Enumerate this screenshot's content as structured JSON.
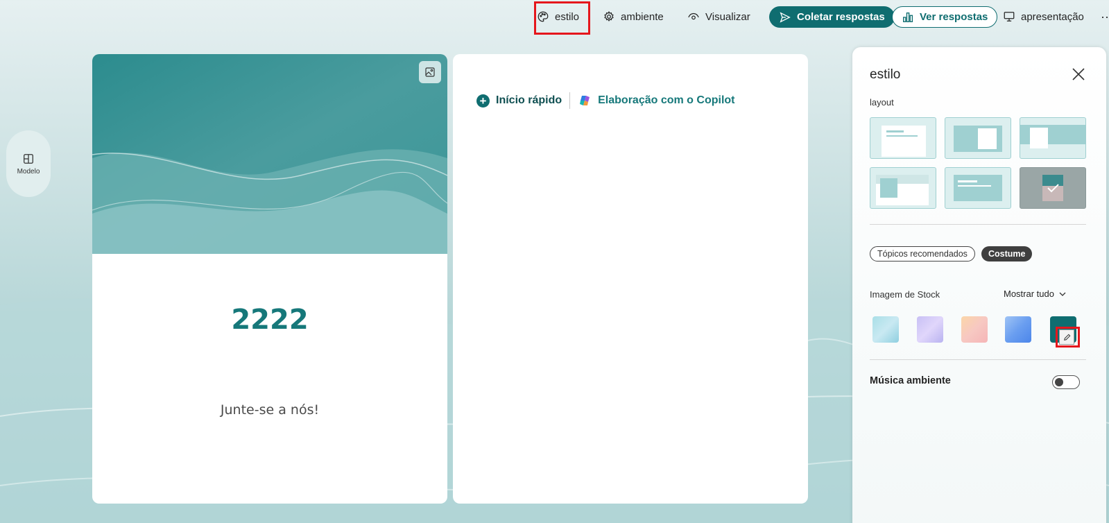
{
  "toolbar": {
    "style_label": "estilo",
    "settings_label": "ambiente",
    "preview_label": "Visualizar",
    "collect_label": "Coletar respostas",
    "responses_label": "Ver respostas",
    "presentation_label": "apresentação",
    "more_label": "···"
  },
  "rail": {
    "template_label": "Modelo"
  },
  "form": {
    "title": "2222",
    "subtitle": "Junte-se a nós!"
  },
  "editor": {
    "quick_start_label": "Início rápido",
    "copilot_label": "Elaboração com o Copilot"
  },
  "style_panel": {
    "title": "estilo",
    "layout_label": "layout",
    "layout_selected_index": 5,
    "tab_recommended": "Tópicos recomendados",
    "tab_custom": "Costume",
    "stock_label": "Imagem de Stock",
    "show_all_label": "Mostrar tudo",
    "music_label": "Música ambiente",
    "music_enabled": false
  },
  "colors": {
    "accent": "#0f6d70",
    "title_teal": "#16787a",
    "highlight_red": "#e5161c"
  },
  "icons": {
    "style": "palette-icon",
    "settings": "gear-icon",
    "preview": "eye-icon",
    "collect": "send-icon",
    "responses": "bar-chart-icon",
    "presentation": "monitor-icon",
    "template": "layout-grid-icon",
    "image": "image-icon",
    "close": "close-icon",
    "edit": "pencil-icon"
  }
}
